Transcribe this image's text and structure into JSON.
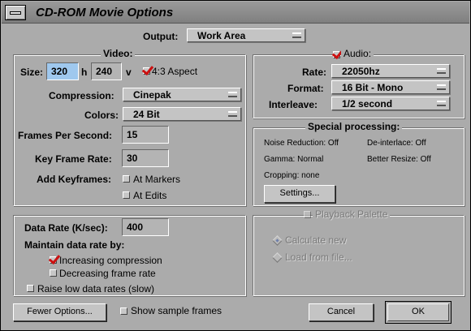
{
  "window": {
    "title": "CD-ROM Movie Options"
  },
  "output": {
    "label": "Output:",
    "value": "Work Area"
  },
  "video": {
    "legend": "Video:",
    "size_label": "Size:",
    "width": "320",
    "h_label": "h",
    "height": "240",
    "v_label": "v",
    "aspect_label": "4:3 Aspect",
    "aspect_checked": true,
    "compression_label": "Compression:",
    "compression_value": "Cinepak",
    "colors_label": "Colors:",
    "colors_value": "24 Bit",
    "fps_label": "Frames Per Second:",
    "fps_value": "15",
    "keyframe_rate_label": "Key Frame Rate:",
    "keyframe_rate_value": "30",
    "add_keyframes_label": "Add Keyframes:",
    "at_markers_label": "At Markers",
    "at_edits_label": "At Edits"
  },
  "audio": {
    "legend": "Audio:",
    "enabled": true,
    "rate_label": "Rate:",
    "rate_value": "22050hz",
    "format_label": "Format:",
    "format_value": "16 Bit - Mono",
    "interleave_label": "Interleave:",
    "interleave_value": "1/2 second"
  },
  "special": {
    "legend": "Special processing:",
    "noise_reduction": "Noise Reduction: Off",
    "deinterlace": "De-interlace: Off",
    "gamma": "Gamma: Normal",
    "better_resize": "Better Resize: Off",
    "cropping": "Cropping: none",
    "settings_button": "Settings..."
  },
  "datarate": {
    "label": "Data Rate (K/sec):",
    "value": "400",
    "maintain_label": "Maintain data rate by:",
    "increasing_label": "Increasing compression",
    "increasing_checked": true,
    "decreasing_label": "Decreasing frame rate",
    "raise_label": "Raise low data rates (slow)"
  },
  "palette": {
    "legend": "Playback Palette",
    "calculate_label": "Calculate new",
    "load_label": "Load from file..."
  },
  "footer": {
    "fewer_options": "Fewer Options...",
    "show_sample_frames": "Show sample frames",
    "cancel": "Cancel",
    "ok": "OK"
  },
  "colors": {
    "window_bg": "#ababab",
    "active_field": "#9fc8ee",
    "check_mark": "#cc1111"
  }
}
